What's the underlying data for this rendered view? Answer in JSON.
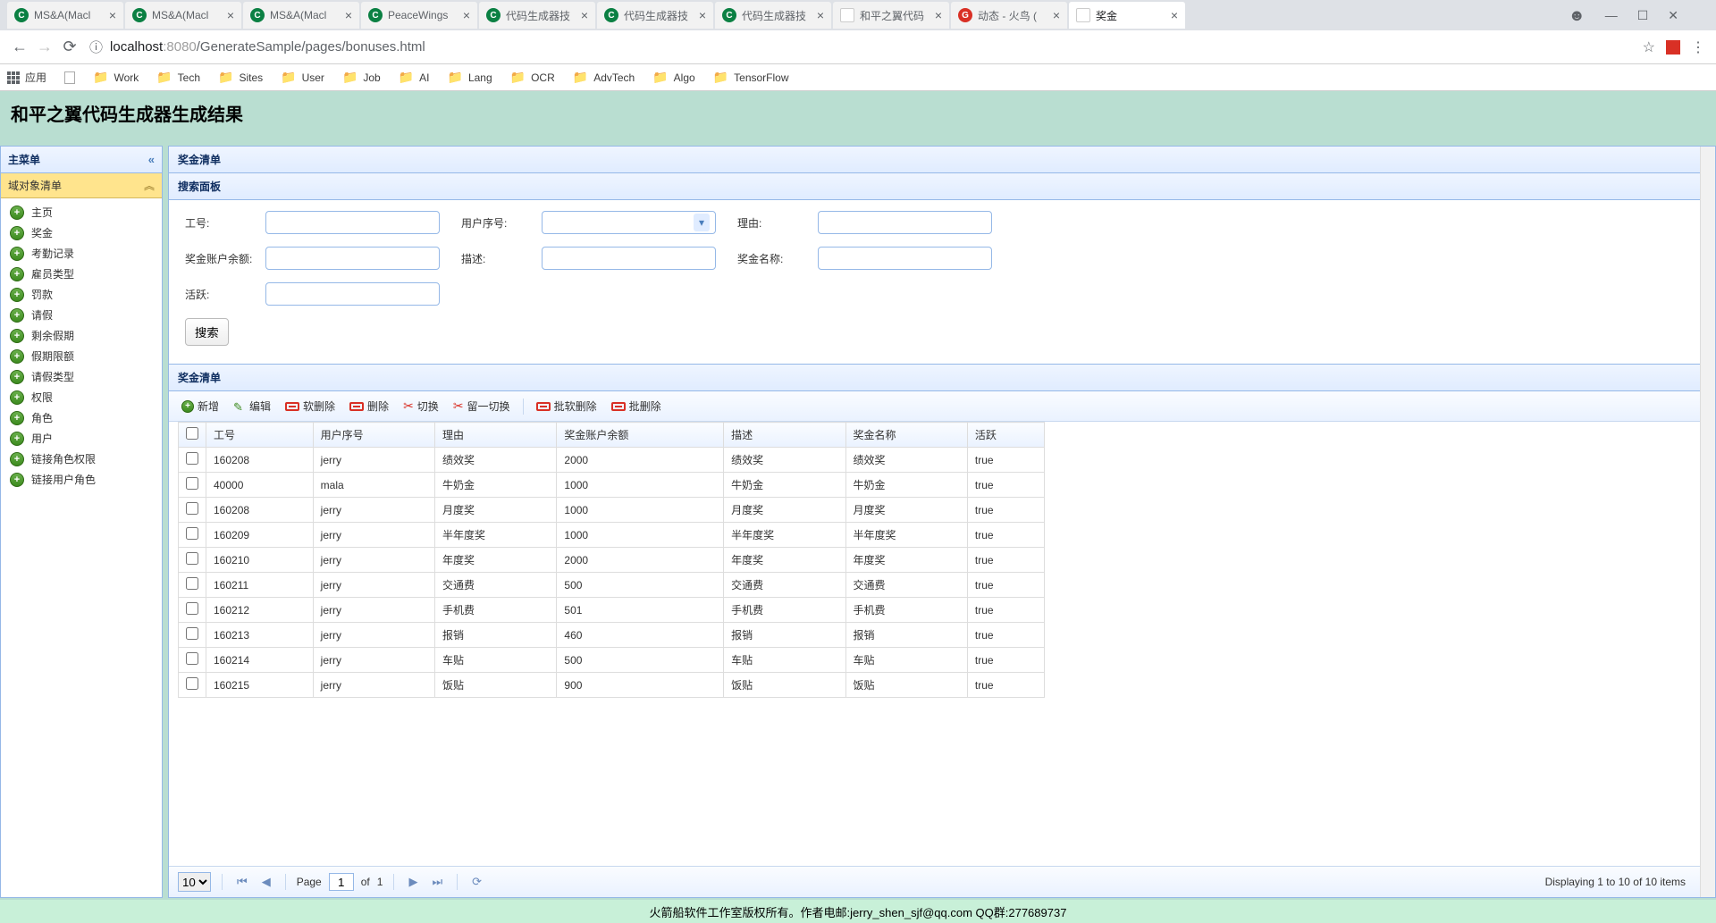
{
  "browser": {
    "tabs": [
      {
        "favicon": "green",
        "title": "MS&A(Macl"
      },
      {
        "favicon": "green",
        "title": "MS&A(Macl"
      },
      {
        "favicon": "green",
        "title": "MS&A(Macl"
      },
      {
        "favicon": "green",
        "title": "PeaceWings"
      },
      {
        "favicon": "green",
        "title": "代码生成器技"
      },
      {
        "favicon": "green",
        "title": "代码生成器技"
      },
      {
        "favicon": "green",
        "title": "代码生成器技"
      },
      {
        "favicon": "doc",
        "title": "和平之翼代码"
      },
      {
        "favicon": "red",
        "title": "动态 - 火鸟 ("
      },
      {
        "favicon": "doc",
        "title": "奖金",
        "active": true
      }
    ],
    "url": {
      "host": "localhost",
      "port": ":8080",
      "path": "/GenerateSample/pages/bonuses.html"
    },
    "bookmarks": {
      "apps": "应用",
      "items": [
        "Work",
        "Tech",
        "Sites",
        "User",
        "Job",
        "AI",
        "Lang",
        "OCR",
        "AdvTech",
        "Algo",
        "TensorFlow"
      ]
    }
  },
  "page": {
    "title": "和平之翼代码生成器生成结果",
    "sidebar": {
      "header": "主菜单",
      "subheader": "域对象清单",
      "items": [
        "主页",
        "奖金",
        "考勤记录",
        "雇员类型",
        "罚款",
        "请假",
        "剩余假期",
        "假期限额",
        "请假类型",
        "权限",
        "角色",
        "用户",
        "链接角色权限",
        "链接用户角色"
      ]
    },
    "main": {
      "list_title": "奖金清单",
      "search_title": "搜索面板",
      "search_fields": {
        "f1_label": "工号:",
        "f2_label": "用户序号:",
        "f3_label": "理由:",
        "f4_label": "奖金账户余额:",
        "f5_label": "描述:",
        "f6_label": "奖金名称:",
        "f7_label": "活跃:"
      },
      "search_btn": "搜索",
      "grid_title": "奖金清单",
      "toolbar": {
        "add": "新增",
        "edit": "编辑",
        "softdel": "软删除",
        "del": "删除",
        "toggle": "切换",
        "keeptoggle": "留一切换",
        "batchsoft": "批软删除",
        "batchdel": "批删除"
      },
      "columns": [
        "工号",
        "用户序号",
        "理由",
        "奖金账户余额",
        "描述",
        "奖金名称",
        "活跃"
      ],
      "rows": [
        {
          "c1": "160208",
          "c2": "jerry",
          "c3": "绩效奖",
          "c4": "2000",
          "c5": "绩效奖",
          "c6": "绩效奖",
          "c7": "true"
        },
        {
          "c1": "40000",
          "c2": "mala",
          "c3": "牛奶金",
          "c4": "1000",
          "c5": "牛奶金",
          "c6": "牛奶金",
          "c7": "true"
        },
        {
          "c1": "160208",
          "c2": "jerry",
          "c3": "月度奖",
          "c4": "1000",
          "c5": "月度奖",
          "c6": "月度奖",
          "c7": "true"
        },
        {
          "c1": "160209",
          "c2": "jerry",
          "c3": "半年度奖",
          "c4": "1000",
          "c5": "半年度奖",
          "c6": "半年度奖",
          "c7": "true"
        },
        {
          "c1": "160210",
          "c2": "jerry",
          "c3": "年度奖",
          "c4": "2000",
          "c5": "年度奖",
          "c6": "年度奖",
          "c7": "true"
        },
        {
          "c1": "160211",
          "c2": "jerry",
          "c3": "交通费",
          "c4": "500",
          "c5": "交通费",
          "c6": "交通费",
          "c7": "true"
        },
        {
          "c1": "160212",
          "c2": "jerry",
          "c3": "手机费",
          "c4": "501",
          "c5": "手机费",
          "c6": "手机费",
          "c7": "true"
        },
        {
          "c1": "160213",
          "c2": "jerry",
          "c3": "报销",
          "c4": "460",
          "c5": "报销",
          "c6": "报销",
          "c7": "true"
        },
        {
          "c1": "160214",
          "c2": "jerry",
          "c3": "车贴",
          "c4": "500",
          "c5": "车贴",
          "c6": "车贴",
          "c7": "true"
        },
        {
          "c1": "160215",
          "c2": "jerry",
          "c3": "饭贴",
          "c4": "900",
          "c5": "饭贴",
          "c6": "饭贴",
          "c7": "true"
        }
      ],
      "pager": {
        "pagesize": "10",
        "page_label": "Page",
        "page": "1",
        "of": "of",
        "total": "1",
        "info": "Displaying 1 to 10 of 10 items"
      }
    },
    "footer": "火箭船软件工作室版权所有。作者电邮:jerry_shen_sjf@qq.com QQ群:277689737"
  }
}
